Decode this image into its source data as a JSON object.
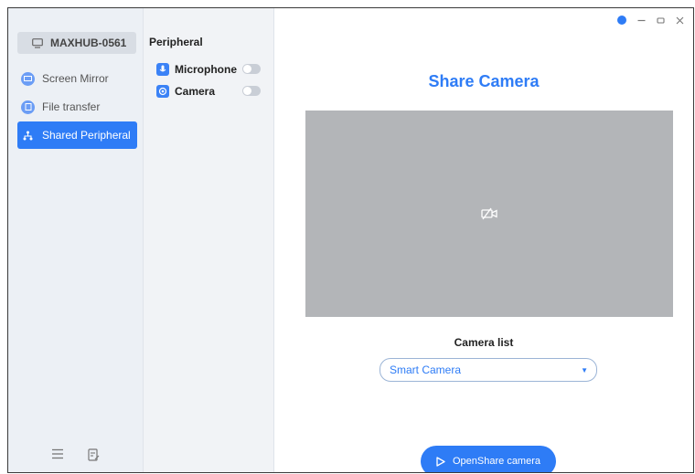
{
  "device": {
    "name": "MAXHUB-0561",
    "icon": "monitor-icon"
  },
  "sidebar": {
    "items": [
      {
        "label": "Screen Mirror",
        "icon": "screen-mirror-icon",
        "active": false
      },
      {
        "label": "File transfer",
        "icon": "file-transfer-icon",
        "active": false
      },
      {
        "label": "Shared Peripheral",
        "icon": "network-icon",
        "active": true
      }
    ],
    "bottom_icons": [
      "menu-icon",
      "feedback-icon"
    ]
  },
  "peripheral": {
    "title": "Peripheral",
    "items": [
      {
        "label": "Microphone",
        "icon": "microphone-icon",
        "enabled": false
      },
      {
        "label": "Camera",
        "icon": "camera-icon",
        "enabled": false
      }
    ]
  },
  "window_controls": [
    "status-icon",
    "minimize-icon",
    "maximize-icon",
    "close-icon"
  ],
  "main": {
    "title": "Share Camera",
    "preview_icon": "camera-off-icon",
    "camera_list_label": "Camera list",
    "camera_selected": "Smart Camera",
    "open_button_label": "OpenShare camera"
  },
  "colors": {
    "accent": "#2e7cf6",
    "preview_bg": "#b3b5b8",
    "sidebar_bg": "#ecf0f5"
  }
}
